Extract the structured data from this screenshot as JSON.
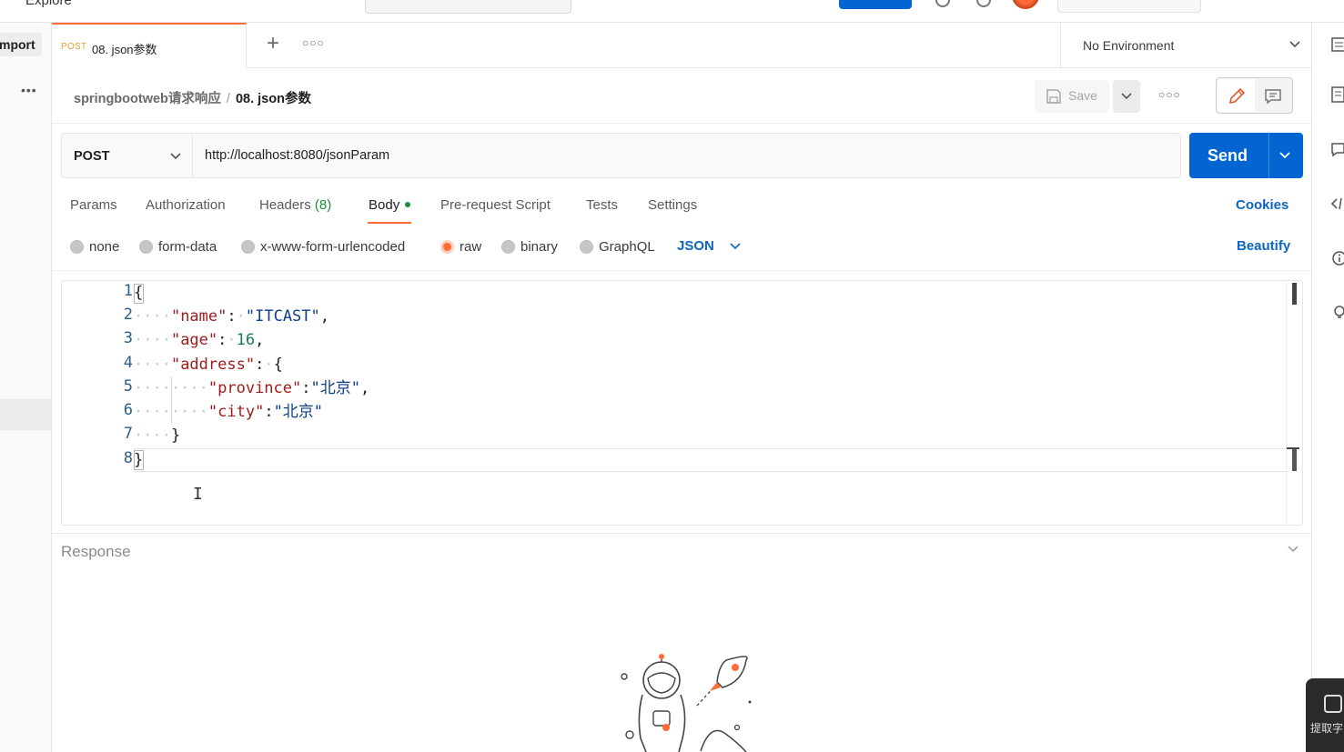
{
  "topbar": {
    "explore": "Explore"
  },
  "sidebar": {
    "import_label": "mport"
  },
  "tab": {
    "method": "POST",
    "name": "08. json参数"
  },
  "environment": {
    "selected": "No Environment"
  },
  "breadcrumb": {
    "collection": "springbootweb请求响应",
    "separator": "/",
    "request": "08. json参数"
  },
  "toolbar": {
    "save_label": "Save"
  },
  "request": {
    "method": "POST",
    "url": "http://localhost:8080/jsonParam",
    "send_label": "Send"
  },
  "subtabs": {
    "params": "Params",
    "authorization": "Authorization",
    "headers": "Headers",
    "headers_count": "(8)",
    "body": "Body",
    "prerequest": "Pre-request Script",
    "tests": "Tests",
    "settings": "Settings",
    "cookies": "Cookies"
  },
  "body_modes": {
    "options": [
      "none",
      "form-data",
      "x-www-form-urlencoded",
      "raw",
      "binary",
      "GraphQL"
    ],
    "selected": "raw",
    "language": "JSON",
    "beautify": "Beautify"
  },
  "editor": {
    "line_numbers": [
      "1",
      "2",
      "3",
      "4",
      "5",
      "6",
      "7",
      "8"
    ],
    "lines": [
      "{",
      "    \"name\": \"ITCAST\",",
      "    \"age\": 16,",
      "    \"address\": {",
      "        \"province\":\"北京\",",
      "        \"city\":\"北京\"",
      "    }",
      "}"
    ]
  },
  "response": {
    "title": "Response"
  },
  "widget": {
    "label": "提取字"
  },
  "colors": {
    "brand": "#ff6c37",
    "send": "#0265d2",
    "link": "#0b66c3",
    "dot": "#1e8e3e"
  }
}
